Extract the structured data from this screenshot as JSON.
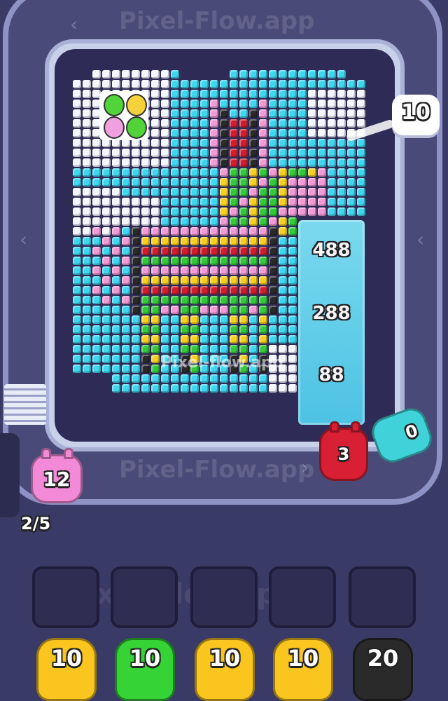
{
  "watermark": {
    "text": "Pixel-Flow.app",
    "center_text": "Pixel-flow.app"
  },
  "board": {
    "target_counter": "10",
    "ice_block": {
      "values": [
        "488",
        "288",
        "88"
      ]
    }
  },
  "conveyor": {
    "active_pig": {
      "count": "12",
      "color": "#f38ad8",
      "progress": "2/5"
    },
    "red_pig": {
      "count": "3",
      "color": "#d81f33"
    },
    "cyan_pig": {
      "count": "0",
      "color": "#3fd2d8"
    }
  },
  "slots": {
    "count": 5
  },
  "queue": [
    {
      "count": "10",
      "color": "#f9c51e"
    },
    {
      "count": "10",
      "color": "#35d335"
    },
    {
      "count": "10",
      "color": "#f9c51e"
    },
    {
      "count": "10",
      "color": "#f9c51e"
    },
    {
      "count": "20",
      "color": "#2a2a2a"
    }
  ],
  "palette": {
    "sky": "#3fd7f0",
    "cloud": "#f4f6ff",
    "pink": "#f29ad6",
    "red": "#d01e2e",
    "black": "#2a2a2a",
    "yellow": "#f7cf20",
    "green": "#34c93a",
    "egg_green": "#52d33a",
    "egg_yellow": "#f5d23a",
    "egg_pink": "#f0a0e0"
  }
}
